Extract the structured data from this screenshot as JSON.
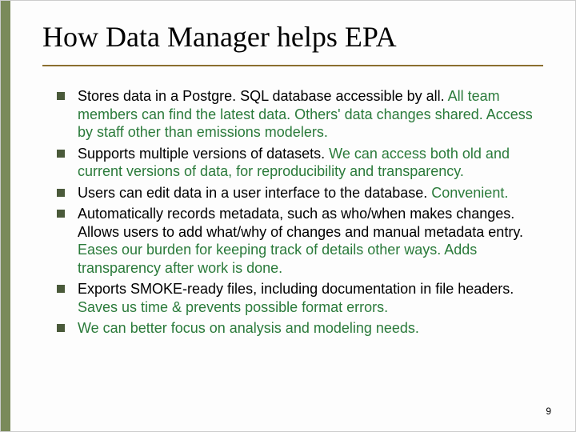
{
  "title": "How Data Manager helps EPA",
  "items": [
    {
      "text": "Stores data in a Postgre. SQL database accessible by all. ",
      "green": "All team members can find the latest data. Others' data changes shared. Access by staff other than emissions modelers."
    },
    {
      "text": "Supports multiple versions of datasets. ",
      "green": "We can access both old and current versions of data, for reproducibility and transparency."
    },
    {
      "text": "Users can edit data in a user interface to the database. ",
      "green": "Convenient."
    },
    {
      "text": "Automatically records metadata, such as who/when makes changes. Allows users to add what/why of changes and manual metadata entry. ",
      "green": "Eases our burden for keeping track of details other ways. Adds transparency after work is done."
    },
    {
      "text": "Exports SMOKE-ready files, including documentation in file headers. ",
      "green": "Saves us time & prevents possible format errors."
    },
    {
      "text": "",
      "green": "We can better focus on analysis and modeling needs."
    }
  ],
  "pageNumber": "9"
}
